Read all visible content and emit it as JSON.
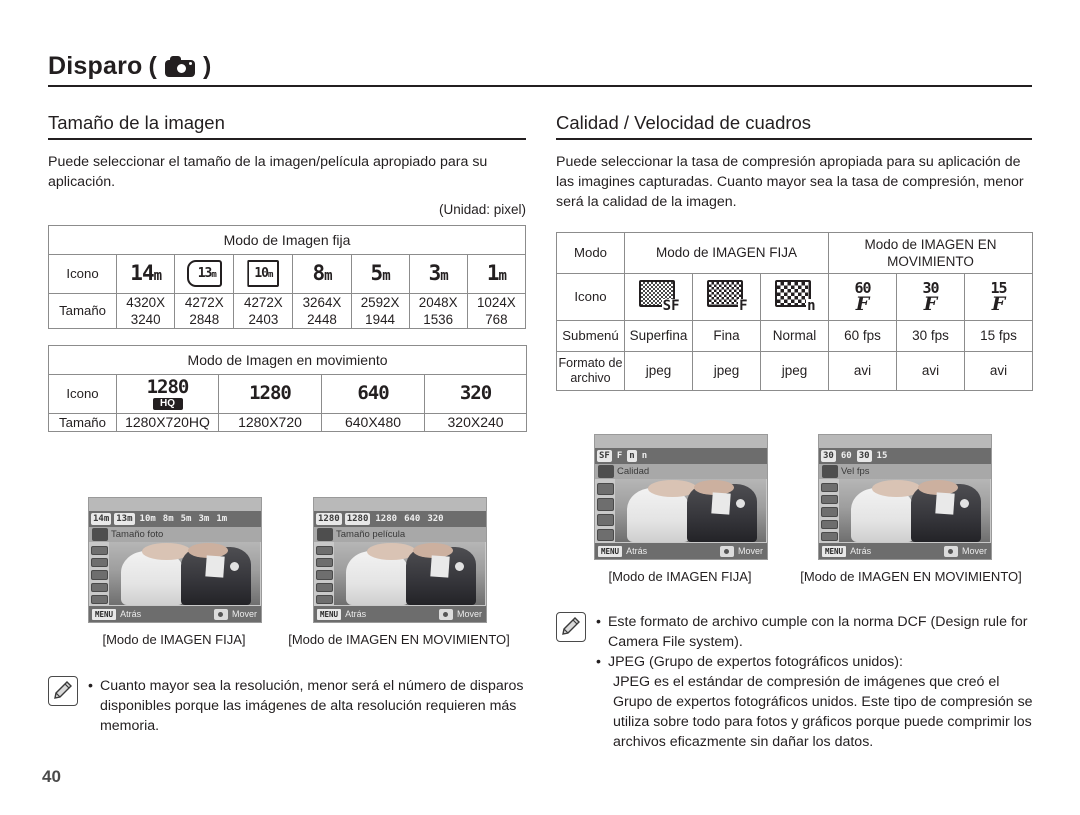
{
  "chapter": {
    "title": "Disparo",
    "icon": "camera-icon",
    "paren_open": "(",
    "paren_close": ")"
  },
  "left": {
    "section_title": "Tamaño de la imagen",
    "intro": "Puede seleccionar el tamaño de la imagen/película apropiado para su aplicación.",
    "unit_note": "(Unidad: pixel)",
    "still_table": {
      "header": "Modo de Imagen fija",
      "row_labels": [
        "Icono",
        "Tamaño"
      ],
      "icons": [
        {
          "num": "14",
          "suffix": "m",
          "style": "plain"
        },
        {
          "num": "13",
          "suffix": "m",
          "style": "wide"
        },
        {
          "num": "10",
          "suffix": "m",
          "style": "pano"
        },
        {
          "num": "8",
          "suffix": "m",
          "style": "plain"
        },
        {
          "num": "5",
          "suffix": "m",
          "style": "plain"
        },
        {
          "num": "3",
          "suffix": "m",
          "style": "plain"
        },
        {
          "num": "1",
          "suffix": "m",
          "style": "plain"
        }
      ],
      "sizes": [
        {
          "w": "4320X",
          "h": "3240"
        },
        {
          "w": "4272X",
          "h": "2848"
        },
        {
          "w": "4272X",
          "h": "2403"
        },
        {
          "w": "3264X",
          "h": "2448"
        },
        {
          "w": "2592X",
          "h": "1944"
        },
        {
          "w": "2048X",
          "h": "1536"
        },
        {
          "w": "1024X",
          "h": "768"
        }
      ]
    },
    "movie_table": {
      "header": "Modo de Imagen en movimiento",
      "row_labels": [
        "Icono",
        "Tamaño"
      ],
      "icons": [
        {
          "num": "1280",
          "badge": "HQ"
        },
        {
          "num": "1280",
          "badge": ""
        },
        {
          "num": "640",
          "badge": ""
        },
        {
          "num": "320",
          "badge": ""
        }
      ],
      "sizes": [
        "1280X720HQ",
        "1280X720",
        "640X480",
        "320X240"
      ]
    },
    "shots": [
      {
        "label": "Tamaño foto",
        "caption": "[Modo de IMAGEN FIJA]",
        "tabs": [
          "14m",
          "13m",
          "10m",
          "8m",
          "5m",
          "3m",
          "1m"
        ],
        "selected_tab": 1
      },
      {
        "label": "Tamaño película",
        "caption": "[Modo de IMAGEN EN MOVIMIENTO]",
        "tabs": [
          "1280",
          "1280",
          "1280",
          "640",
          "320"
        ],
        "selected_tab": 1
      }
    ],
    "note": {
      "icon": "note-pencil-icon",
      "bullet": "•",
      "text": "Cuanto mayor sea la resolución, menor será el número de disparos disponibles porque las imágenes de alta resolución requieren más memoria."
    }
  },
  "right": {
    "section_title": "Calidad / Velocidad de cuadros",
    "intro": "Puede seleccionar la tasa de compresión apropiada para su aplicación de las imagines capturadas. Cuanto mayor sea la tasa de compresión, menor será la calidad de la imagen.",
    "quality_table": {
      "row_labels": [
        "Modo",
        "Icono",
        "Submenú",
        "Formato de archivo"
      ],
      "group_still": "Modo de IMAGEN FIJA",
      "group_movie": "Modo de IMAGEN EN MOVIMIENTO",
      "icons": [
        {
          "kind": "checker",
          "density": "fine",
          "tag": "SF"
        },
        {
          "kind": "checker",
          "density": "med",
          "tag": "F"
        },
        {
          "kind": "checker",
          "density": "coarse",
          "tag": "n"
        },
        {
          "kind": "fps",
          "num": "60",
          "tag": "F"
        },
        {
          "kind": "fps",
          "num": "30",
          "tag": "F"
        },
        {
          "kind": "fps",
          "num": "15",
          "tag": "F"
        }
      ],
      "submenu": [
        "Superfina",
        "Fina",
        "Normal",
        "60 fps",
        "30 fps",
        "15 fps"
      ],
      "format": [
        "jpeg",
        "jpeg",
        "jpeg",
        "avi",
        "avi",
        "avi"
      ]
    },
    "shots": [
      {
        "label": "Calidad",
        "caption": "[Modo de IMAGEN FIJA]",
        "tabs": [
          "SF",
          "F",
          "n",
          "n"
        ],
        "selected_tab": 2
      },
      {
        "label": "Vel fps",
        "caption": "[Modo de IMAGEN EN MOVIMIENTO]",
        "tabs": [
          "30",
          "60",
          "30",
          "15"
        ],
        "selected_tab": 2
      }
    ],
    "note": {
      "icon": "note-pencil-icon",
      "bullet": "•",
      "line1": "Este formato de archivo cumple con la norma DCF (Design rule for Camera File system).",
      "line2": "JPEG (Grupo de expertos fotográficos unidos):",
      "line3": "JPEG es el estándar de compresión de imágenes que creó el Grupo de expertos fotográficos unidos. Este tipo de compresión se utiliza sobre todo para fotos y gráficos porque puede comprimir los archivos eficazmente sin dañar los datos."
    }
  },
  "shot_ui": {
    "back_badge": "MENU",
    "back_text": "Atrás",
    "move_text": "Mover"
  },
  "page_number": "40"
}
